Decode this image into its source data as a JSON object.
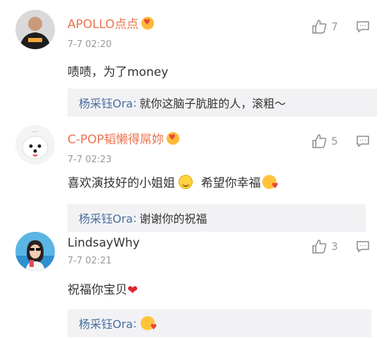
{
  "comments": [
    {
      "username": "APOLLO点点",
      "avatar_icon": "avatar-black-shirt",
      "timestamp": "7-7 02:20",
      "text": "啧啧，为了money",
      "likes": "7",
      "reply": {
        "author": "杨采钰Ora",
        "text": "就你这脑子肮脏的人，滚粗～"
      }
    },
    {
      "username": "C-POP韬懒得屌妳",
      "avatar_icon": "avatar-white-dog",
      "timestamp": "7-7 02:23",
      "text_part1": "喜欢演技好的小姐姐",
      "text_part2": "希望你幸福",
      "likes": "5",
      "reply": {
        "author": "杨采钰Ora",
        "text": "谢谢你的祝福"
      }
    },
    {
      "username": "LindsayWhy",
      "avatar_icon": "avatar-girl-photo",
      "timestamp": "7-7 02:21",
      "text": "祝福你宝贝",
      "likes": "3",
      "reply": {
        "author": "杨采钰Ora",
        "text": ""
      }
    }
  ],
  "reply_separator": ":",
  "colors": {
    "username_accent": "#eb7350",
    "reply_name": "#4a6f9e",
    "reply_bg": "#f2f2f5"
  }
}
